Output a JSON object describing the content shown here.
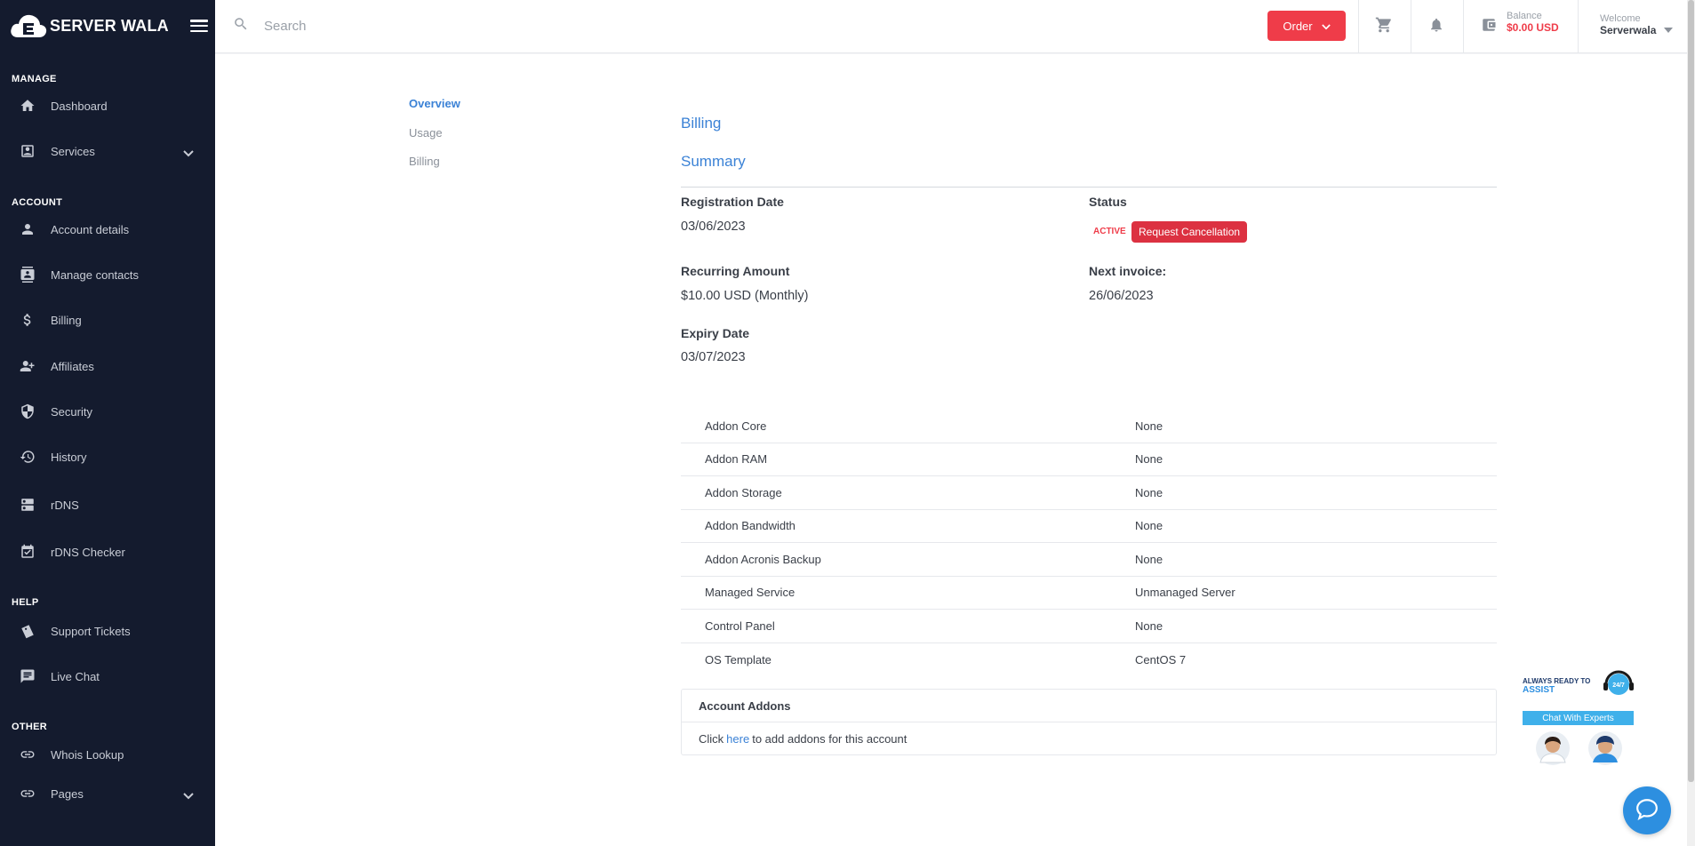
{
  "brand": {
    "name": "SERVER WALA"
  },
  "sidebar": {
    "sections": [
      {
        "title": "MANAGE"
      },
      {
        "title": "ACCOUNT"
      },
      {
        "title": "HELP"
      },
      {
        "title": "OTHER"
      }
    ],
    "items": [
      {
        "label": "Dashboard",
        "icon": "home-icon"
      },
      {
        "label": "Services",
        "icon": "services-icon"
      },
      {
        "label": "Account details",
        "icon": "person-icon"
      },
      {
        "label": "Manage contacts",
        "icon": "contacts-icon"
      },
      {
        "label": "Billing",
        "icon": "dollar-icon"
      },
      {
        "label": "Affiliates",
        "icon": "affiliates-icon"
      },
      {
        "label": "Security",
        "icon": "shield-icon"
      },
      {
        "label": "History",
        "icon": "history-icon"
      },
      {
        "label": "rDNS",
        "icon": "server-icon"
      },
      {
        "label": "rDNS Checker",
        "icon": "checker-icon"
      },
      {
        "label": "Support Tickets",
        "icon": "tickets-icon"
      },
      {
        "label": "Live Chat",
        "icon": "chat-icon"
      },
      {
        "label": "Whois Lookup",
        "icon": "link-icon"
      },
      {
        "label": "Pages",
        "icon": "link-icon"
      }
    ]
  },
  "topbar": {
    "search_placeholder": "Search",
    "order_label": "Order",
    "balance_label": "Balance",
    "balance_value": "$0.00 USD",
    "welcome_label": "Welcome",
    "username": "Serverwala"
  },
  "tabs": [
    {
      "label": "Overview"
    },
    {
      "label": "Usage"
    },
    {
      "label": "Billing"
    }
  ],
  "billing": {
    "heading": "Billing",
    "summary_heading": "Summary",
    "registration_label": "Registration Date",
    "registration_value": "03/06/2023",
    "status_label": "Status",
    "status_value": "ACTIVE",
    "cancel_label": "Request Cancellation",
    "recurring_label": "Recurring Amount",
    "recurring_value": "$10.00 USD (Monthly)",
    "next_invoice_label": "Next invoice:",
    "next_invoice_value": "26/06/2023",
    "expiry_label": "Expiry Date",
    "expiry_value": "03/07/2023"
  },
  "addons": [
    {
      "name": "Addon Core",
      "value": "None"
    },
    {
      "name": "Addon RAM",
      "value": "None"
    },
    {
      "name": "Addon Storage",
      "value": "None"
    },
    {
      "name": "Addon Bandwidth",
      "value": "None"
    },
    {
      "name": "Addon Acronis Backup",
      "value": "None"
    },
    {
      "name": "Managed Service",
      "value": "Unmanaged Server"
    },
    {
      "name": "Control Panel",
      "value": "None"
    },
    {
      "name": "OS Template",
      "value": "CentOS 7"
    }
  ],
  "account_addons": {
    "heading": "Account Addons",
    "text_before": "Click",
    "link": "here",
    "text_after": "to add addons for this account"
  },
  "assist": {
    "line1": "ALWAYS READY TO",
    "line2": "ASSIST",
    "badge": "24/7",
    "bar": "Chat With Experts"
  },
  "colors": {
    "accent": "#ef3c49",
    "link": "#3b82d6",
    "sidebar": "#141b2e"
  }
}
